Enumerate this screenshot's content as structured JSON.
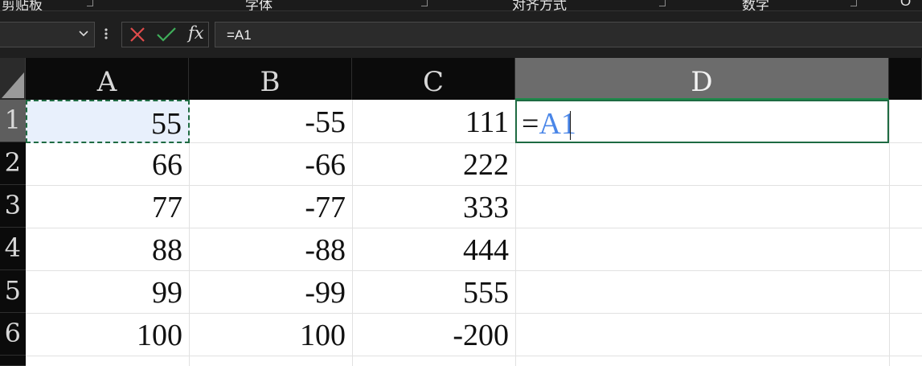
{
  "ribbon": {
    "groups": [
      "剪贴板",
      "字体",
      "对齐方式",
      "数字",
      "O"
    ]
  },
  "formula_bar": {
    "name_box": "",
    "cancel_icon": "x-icon",
    "enter_icon": "check-icon",
    "fx_label": "fx",
    "formula": "=A1"
  },
  "columns": [
    "A",
    "B",
    "C",
    "D"
  ],
  "rows": [
    "1",
    "2",
    "3",
    "4",
    "5",
    "6"
  ],
  "cells": [
    [
      "55",
      "-55",
      "111"
    ],
    [
      "66",
      "-66",
      "222"
    ],
    [
      "77",
      "-77",
      "333"
    ],
    [
      "88",
      "-88",
      "444"
    ],
    [
      "99",
      "-99",
      "555"
    ],
    [
      "100",
      "100",
      "-200"
    ]
  ],
  "active_cell": {
    "equals": "=",
    "reference": "A1"
  },
  "colors": {
    "selection_border": "#1e6b42",
    "reference_text": "#4a86e8",
    "cancel": "#e04b4b",
    "enter": "#3fae5a"
  }
}
